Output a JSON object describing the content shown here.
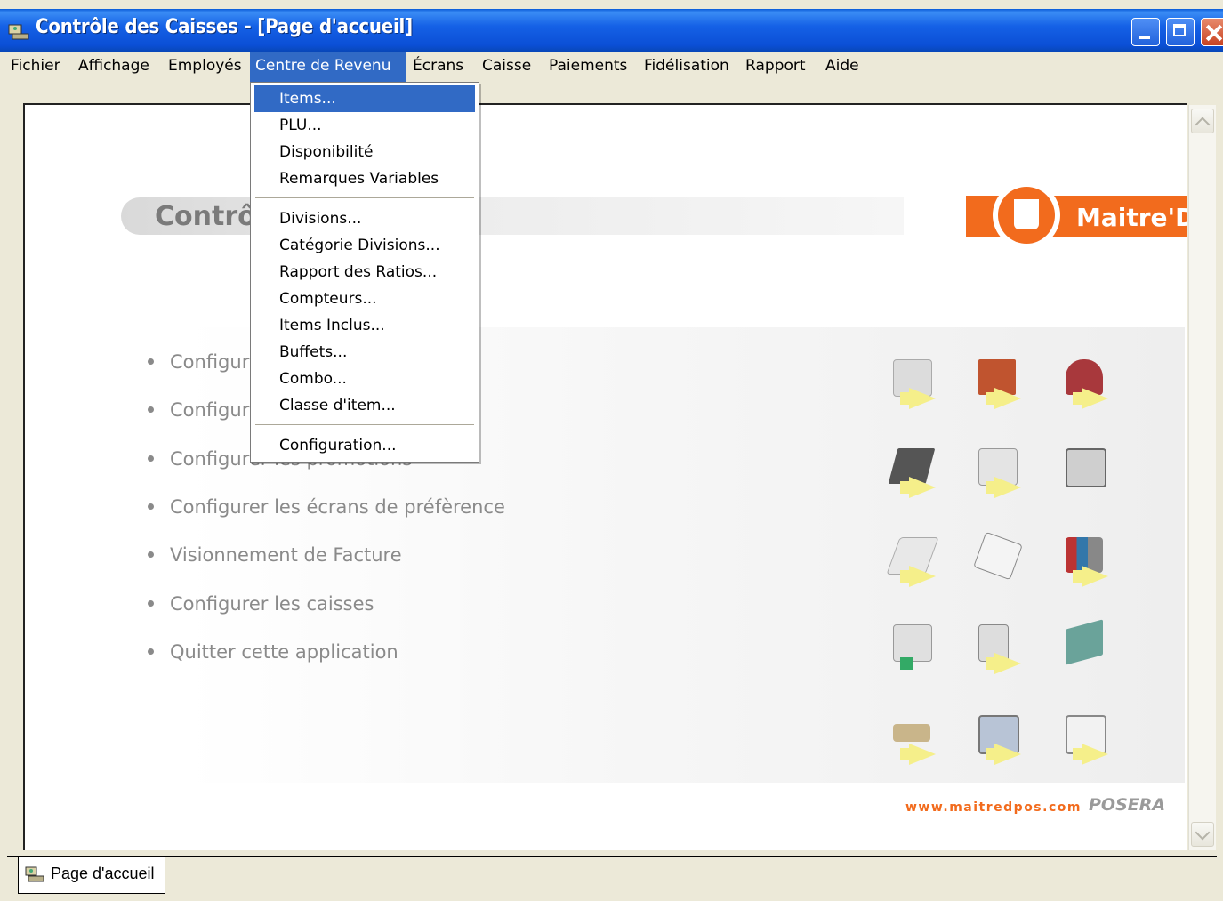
{
  "window": {
    "title": "Contrôle des Caisses - [Page d'accueil]",
    "icons": [
      "app-icon",
      "minimize-icon",
      "maximize-icon",
      "close-icon"
    ]
  },
  "menubar": {
    "items": [
      {
        "label": "Fichier"
      },
      {
        "label": "Affichage"
      },
      {
        "label": "Employés"
      },
      {
        "label": "Centre de Revenu",
        "active": true
      },
      {
        "label": "Écrans"
      },
      {
        "label": "Caisse"
      },
      {
        "label": "Paiements"
      },
      {
        "label": "Fidélisation"
      },
      {
        "label": "Rapport"
      },
      {
        "label": "Aide"
      }
    ]
  },
  "dropdown": {
    "items": [
      {
        "label": "Items...",
        "highlighted": true
      },
      {
        "label": "PLU..."
      },
      {
        "label": "Disponibilité"
      },
      {
        "label": "Remarques Variables"
      },
      {
        "label": "Divisions..."
      },
      {
        "label": "Catégorie Divisions..."
      },
      {
        "label": "Rapport des Ratios..."
      },
      {
        "label": "Compteurs..."
      },
      {
        "label": "Items Inclus..."
      },
      {
        "label": "Buffets..."
      },
      {
        "label": "Combo..."
      },
      {
        "label": "Classe d'item..."
      },
      {
        "label": "Configuration..."
      }
    ]
  },
  "page": {
    "title": "Contrô",
    "brand": "Maitre'D",
    "links": [
      {
        "label": "Configur"
      },
      {
        "label": "Configur"
      },
      {
        "label": "Configurer les promotions"
      },
      {
        "label": "Configurer les écrans de préfèrence"
      },
      {
        "label": "Visionnement de Facture"
      },
      {
        "label": "Configurer les caisses"
      },
      {
        "label": "Quitter cette application"
      }
    ],
    "footer_url": "www.maitredpos.com",
    "footer_brand": "POSERA",
    "accent_color": "#f26b1d"
  },
  "tabs": [
    {
      "label": "Page d'accueil"
    }
  ]
}
